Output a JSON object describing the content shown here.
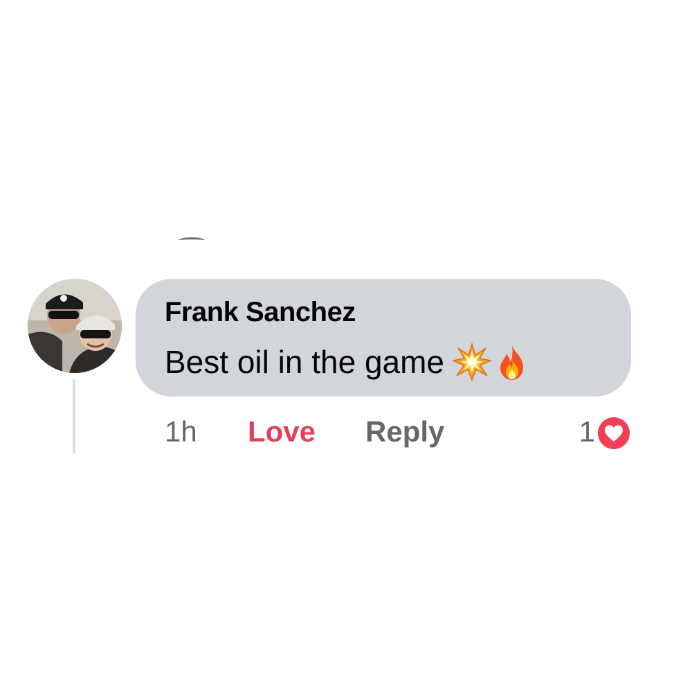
{
  "comment": {
    "author": "Frank Sanchez",
    "text": "Best oil in the game",
    "emojis": [
      "collision-emoji",
      "fire-emoji"
    ],
    "avatar": "profile-photo"
  },
  "actions": {
    "time": "1h",
    "love_label": "Love",
    "reply_label": "Reply"
  },
  "reactions": {
    "count": "1",
    "type": "heart-icon",
    "color": "#f33e58"
  },
  "colors": {
    "bubble": "#d2d5da",
    "love": "#e0415b",
    "muted": "#65676b"
  }
}
